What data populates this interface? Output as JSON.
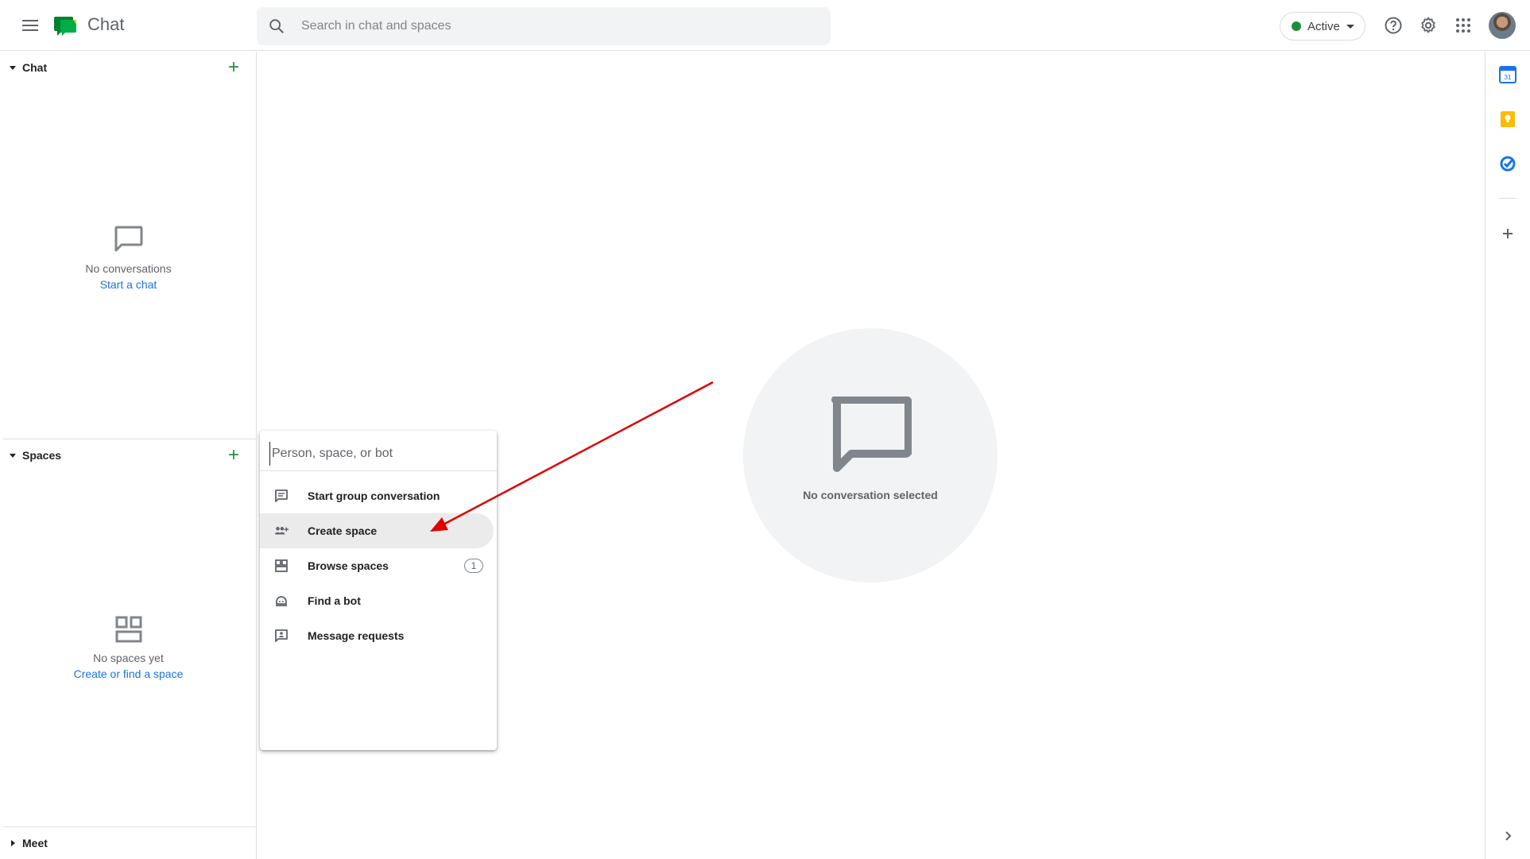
{
  "app": {
    "title": "Chat"
  },
  "search": {
    "placeholder": "Search in chat and spaces"
  },
  "header": {
    "status_label": "Active",
    "status_color": "#1e8e3e"
  },
  "sidebar": {
    "chat_section": {
      "label": "Chat",
      "empty_text": "No conversations",
      "empty_link": "Start a chat"
    },
    "spaces_section": {
      "label": "Spaces",
      "empty_text": "No spaces yet",
      "empty_link": "Create or find a space"
    },
    "meet_section": {
      "label": "Meet"
    }
  },
  "main": {
    "empty_text": "No conversation selected"
  },
  "popup": {
    "input_placeholder": "Person, space, or bot",
    "items": [
      {
        "label": "Start group conversation",
        "icon": "group-chat-icon"
      },
      {
        "label": "Create space",
        "icon": "create-space-icon"
      },
      {
        "label": "Browse spaces",
        "icon": "browse-spaces-icon",
        "badge": "1"
      },
      {
        "label": "Find a bot",
        "icon": "bot-icon"
      },
      {
        "label": "Message requests",
        "icon": "message-requests-icon"
      }
    ]
  },
  "right_rail": {
    "icons": [
      "calendar-icon",
      "keep-icon",
      "tasks-icon",
      "add-icon",
      "chevron-right-icon"
    ],
    "calendar_day": "31"
  },
  "colors": {
    "accent_green": "#1e8e3e",
    "link_blue": "#1a73e8",
    "annotation_red": "#e00000"
  }
}
